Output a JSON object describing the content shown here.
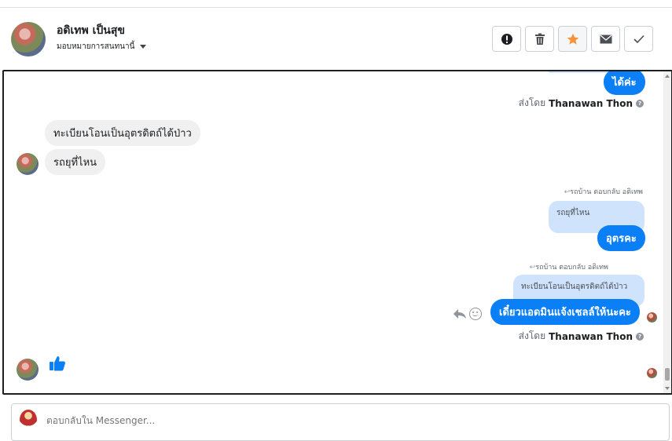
{
  "header": {
    "contact_name": "อดิเทพ เป็นสุข",
    "assign_label": "มอบหมายการสนทนานี้"
  },
  "toolbar": {
    "spam_icon": "exclamation-icon",
    "delete_icon": "trash-icon",
    "star_icon": "star-icon",
    "unread_icon": "envelope-icon",
    "done_icon": "check-icon",
    "star_color": "#f7923b"
  },
  "messages": {
    "out_top": "ได้ค่ะ",
    "sent_by_prefix": "ส่งโดย",
    "sent_by_name": "Thanawan Thon",
    "in_1": "ทะเบียนโอนเป็นอุตรดิตถ์ได้ป่าว",
    "in_2": "รถยุที่ไหน",
    "reply_label_1": "รถบ้าน ตอบกลับ อดิเทพ",
    "quote_1": "รถยุที่ไหน",
    "out_1": "อุตรคะ",
    "reply_label_2": "รถบ้าน ตอบกลับ อดิเทพ",
    "quote_2": "ทะเบียนโอนเป็นอุตรดิตถ์ได้ป่าว",
    "out_2": "เดี๋ยวแอดมินแจ้งเชลล์ให้นะคะ",
    "like_icon": "thumbs-up-icon"
  },
  "composer": {
    "placeholder": "ตอบกลับใน Messenger..."
  },
  "colors": {
    "accent": "#0b7ff5",
    "quote_bg": "#cfe3fc"
  }
}
